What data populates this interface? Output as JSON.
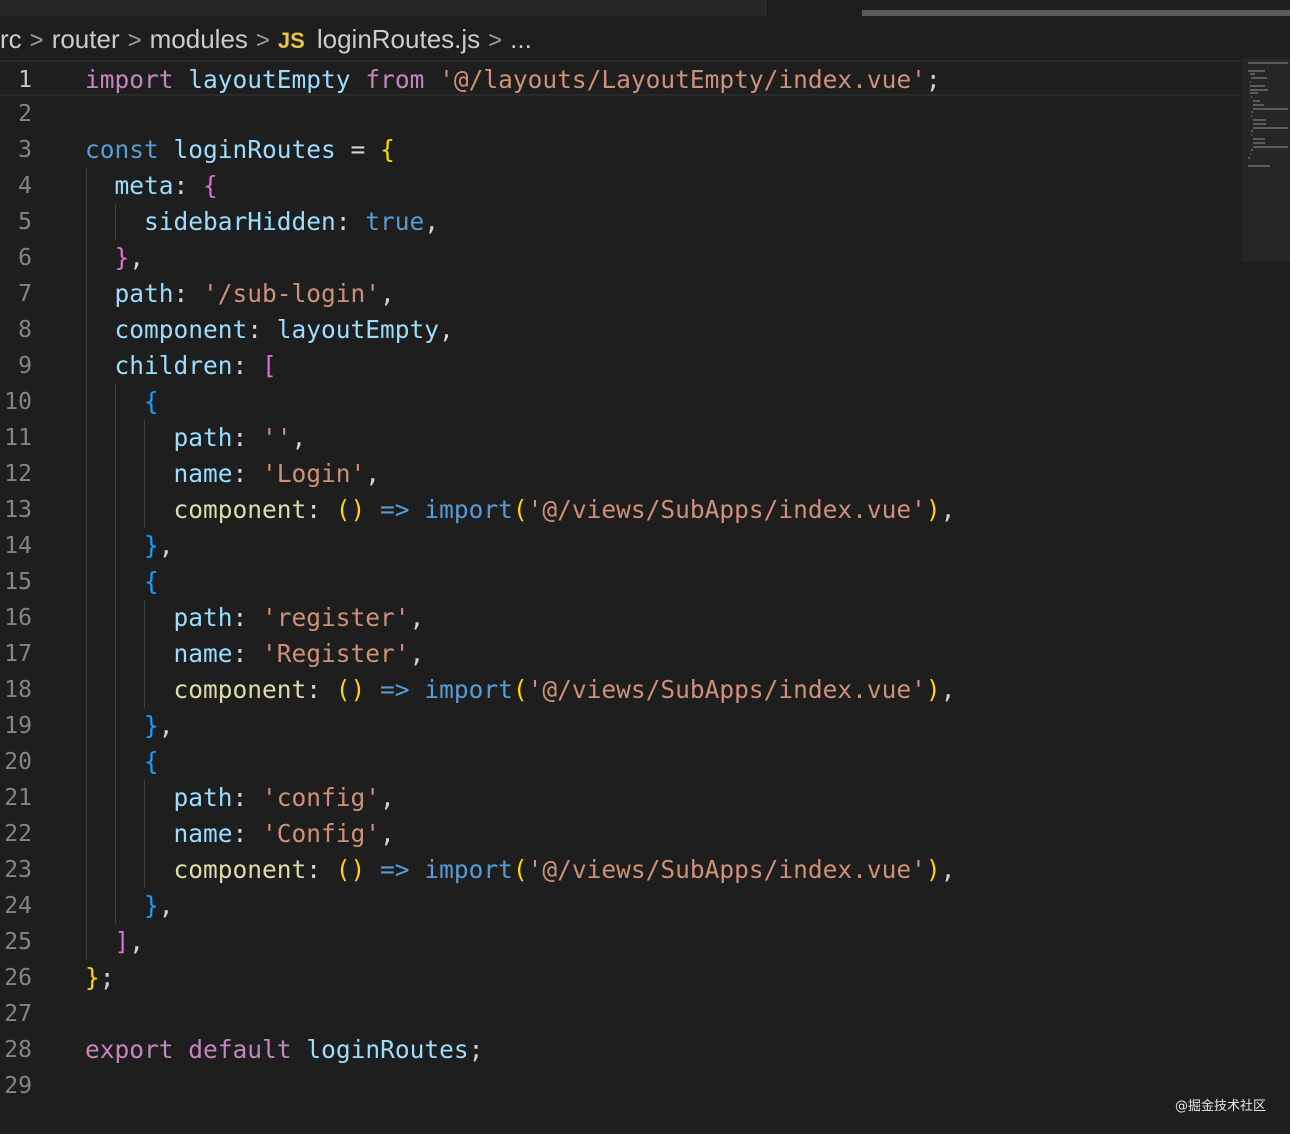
{
  "breadcrumb": {
    "segments": [
      "rc",
      "router",
      "modules",
      "loginRoutes.js",
      "..."
    ],
    "file_icon": "JS",
    "separator": ">"
  },
  "editor": {
    "current_line": 1,
    "lines": [
      {
        "n": "1",
        "tokens": [
          [
            "import",
            "kw"
          ],
          [
            " ",
            ""
          ],
          [
            "layoutEmpty",
            "var"
          ],
          [
            " ",
            ""
          ],
          [
            "from",
            "kw"
          ],
          [
            " ",
            ""
          ],
          [
            "'@/layouts/LayoutEmpty/index.vue'",
            "str"
          ],
          [
            ";",
            "punc"
          ]
        ]
      },
      {
        "n": "2",
        "tokens": []
      },
      {
        "n": "3",
        "tokens": [
          [
            "const",
            "decl"
          ],
          [
            " ",
            ""
          ],
          [
            "loginRoutes",
            "var"
          ],
          [
            " = ",
            "punc"
          ],
          [
            "{",
            "b1"
          ]
        ]
      },
      {
        "n": "4",
        "tokens": [
          [
            "  meta",
            "var"
          ],
          [
            ": ",
            "punc"
          ],
          [
            "{",
            "b2"
          ]
        ]
      },
      {
        "n": "5",
        "tokens": [
          [
            "    sidebarHidden",
            "var"
          ],
          [
            ": ",
            "punc"
          ],
          [
            "true",
            "decl"
          ],
          [
            ",",
            "punc"
          ]
        ]
      },
      {
        "n": "6",
        "tokens": [
          [
            "  ",
            ""
          ],
          [
            "}",
            "b2"
          ],
          [
            ",",
            "punc"
          ]
        ]
      },
      {
        "n": "7",
        "tokens": [
          [
            "  path",
            "var"
          ],
          [
            ": ",
            "punc"
          ],
          [
            "'/sub-login'",
            "str"
          ],
          [
            ",",
            "punc"
          ]
        ]
      },
      {
        "n": "8",
        "tokens": [
          [
            "  component",
            "var"
          ],
          [
            ": ",
            "punc"
          ],
          [
            "layoutEmpty",
            "var"
          ],
          [
            ",",
            "punc"
          ]
        ]
      },
      {
        "n": "9",
        "tokens": [
          [
            "  children",
            "var"
          ],
          [
            ": ",
            "punc"
          ],
          [
            "[",
            "b2"
          ]
        ]
      },
      {
        "n": "10",
        "tokens": [
          [
            "    ",
            ""
          ],
          [
            "{",
            "b3"
          ]
        ]
      },
      {
        "n": "11",
        "tokens": [
          [
            "      path",
            "var"
          ],
          [
            ": ",
            "punc"
          ],
          [
            "''",
            "str"
          ],
          [
            ",",
            "punc"
          ]
        ]
      },
      {
        "n": "12",
        "tokens": [
          [
            "      name",
            "var"
          ],
          [
            ": ",
            "punc"
          ],
          [
            "'Login'",
            "str"
          ],
          [
            ",",
            "punc"
          ]
        ]
      },
      {
        "n": "13",
        "tokens": [
          [
            "      component",
            "fn"
          ],
          [
            ": ",
            "punc"
          ],
          [
            "()",
            "b1"
          ],
          [
            " => ",
            "decl"
          ],
          [
            "import",
            "import"
          ],
          [
            "(",
            "b1"
          ],
          [
            "'@/views/SubApps/index.vue'",
            "str"
          ],
          [
            ")",
            "b1"
          ],
          [
            ",",
            "punc"
          ]
        ]
      },
      {
        "n": "14",
        "tokens": [
          [
            "    ",
            ""
          ],
          [
            "}",
            "b3"
          ],
          [
            ",",
            "punc"
          ]
        ]
      },
      {
        "n": "15",
        "tokens": [
          [
            "    ",
            ""
          ],
          [
            "{",
            "b3"
          ]
        ]
      },
      {
        "n": "16",
        "tokens": [
          [
            "      path",
            "var"
          ],
          [
            ": ",
            "punc"
          ],
          [
            "'register'",
            "str"
          ],
          [
            ",",
            "punc"
          ]
        ]
      },
      {
        "n": "17",
        "tokens": [
          [
            "      name",
            "var"
          ],
          [
            ": ",
            "punc"
          ],
          [
            "'Register'",
            "str"
          ],
          [
            ",",
            "punc"
          ]
        ]
      },
      {
        "n": "18",
        "tokens": [
          [
            "      component",
            "fn"
          ],
          [
            ": ",
            "punc"
          ],
          [
            "()",
            "b1"
          ],
          [
            " => ",
            "decl"
          ],
          [
            "import",
            "import"
          ],
          [
            "(",
            "b1"
          ],
          [
            "'@/views/SubApps/index.vue'",
            "str"
          ],
          [
            ")",
            "b1"
          ],
          [
            ",",
            "punc"
          ]
        ]
      },
      {
        "n": "19",
        "tokens": [
          [
            "    ",
            ""
          ],
          [
            "}",
            "b3"
          ],
          [
            ",",
            "punc"
          ]
        ]
      },
      {
        "n": "20",
        "tokens": [
          [
            "    ",
            ""
          ],
          [
            "{",
            "b3"
          ]
        ]
      },
      {
        "n": "21",
        "tokens": [
          [
            "      path",
            "var"
          ],
          [
            ": ",
            "punc"
          ],
          [
            "'config'",
            "str"
          ],
          [
            ",",
            "punc"
          ]
        ]
      },
      {
        "n": "22",
        "tokens": [
          [
            "      name",
            "var"
          ],
          [
            ": ",
            "punc"
          ],
          [
            "'Config'",
            "str"
          ],
          [
            ",",
            "punc"
          ]
        ]
      },
      {
        "n": "23",
        "tokens": [
          [
            "      component",
            "fn"
          ],
          [
            ": ",
            "punc"
          ],
          [
            "()",
            "b1"
          ],
          [
            " => ",
            "decl"
          ],
          [
            "import",
            "import"
          ],
          [
            "(",
            "b1"
          ],
          [
            "'@/views/SubApps/index.vue'",
            "str"
          ],
          [
            ")",
            "b1"
          ],
          [
            ",",
            "punc"
          ]
        ]
      },
      {
        "n": "24",
        "tokens": [
          [
            "    ",
            ""
          ],
          [
            "}",
            "b3"
          ],
          [
            ",",
            "punc"
          ]
        ]
      },
      {
        "n": "25",
        "tokens": [
          [
            "  ",
            ""
          ],
          [
            "]",
            "b2"
          ],
          [
            ",",
            "punc"
          ]
        ]
      },
      {
        "n": "26",
        "tokens": [
          [
            "}",
            "b1"
          ],
          [
            ";",
            "punc"
          ]
        ]
      },
      {
        "n": "27",
        "tokens": []
      },
      {
        "n": "28",
        "tokens": [
          [
            "export",
            "kw"
          ],
          [
            " ",
            ""
          ],
          [
            "default",
            "kw"
          ],
          [
            " ",
            ""
          ],
          [
            "loginRoutes",
            "var"
          ],
          [
            ";",
            "punc"
          ]
        ]
      },
      {
        "n": "29",
        "tokens": []
      }
    ]
  },
  "watermark": "@掘金技术社区",
  "colors": {
    "background": "#1e1e1e",
    "keyword": "#c586c0",
    "declaration": "#569cd6",
    "variable": "#9cdcfe",
    "string": "#ce9178",
    "bracket_gold": "#ffd700",
    "bracket_orchid": "#da70d6",
    "bracket_blue": "#179fff"
  }
}
